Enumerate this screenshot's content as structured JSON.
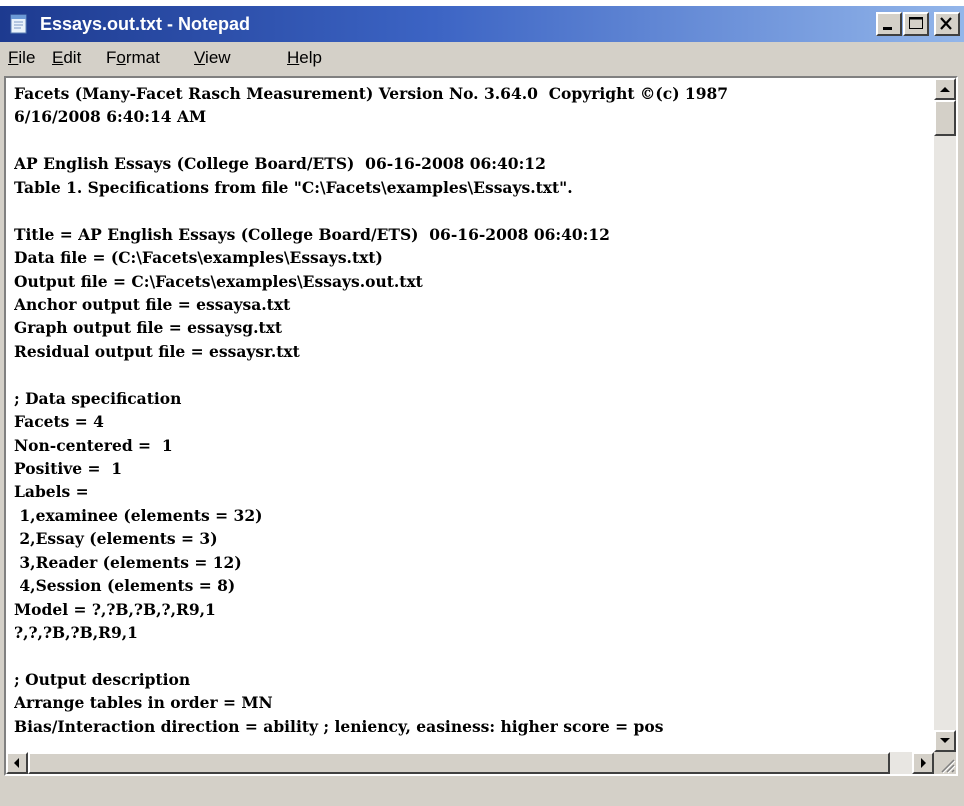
{
  "window": {
    "title": "Essays.out.txt - Notepad",
    "icon": "notepad-icon",
    "titlebar_color_start": "#1d3a8f",
    "titlebar_color_end": "#93b6ea"
  },
  "menu": {
    "items": [
      {
        "accel": "F",
        "rest": "ile"
      },
      {
        "accel": "E",
        "rest": "dit"
      },
      {
        "pre": "F",
        "accel": "o",
        "rest": "rmat"
      },
      {
        "accel": "V",
        "rest": "iew"
      },
      {
        "accel": "H",
        "rest": "elp"
      }
    ]
  },
  "document": {
    "lines": [
      "Facets (Many-Facet Rasch Measurement) Version No. 3.64.0  Copyright ©(c) 1987",
      "6/16/2008 6:40:14 AM",
      "",
      "AP English Essays (College Board/ETS)  06-16-2008 06:40:12",
      "Table 1. Specifications from file \"C:\\Facets\\examples\\Essays.txt\".",
      "",
      "Title = AP English Essays (College Board/ETS)  06-16-2008 06:40:12",
      "Data file = (C:\\Facets\\examples\\Essays.txt)",
      "Output file = C:\\Facets\\examples\\Essays.out.txt",
      "Anchor output file = essaysa.txt",
      "Graph output file = essaysg.txt",
      "Residual output file = essaysr.txt",
      "",
      "; Data specification",
      "Facets = 4",
      "Non-centered =  1",
      "Positive =  1",
      "Labels =",
      " 1,examinee (elements = 32)",
      " 2,Essay (elements = 3)",
      " 3,Reader (elements = 12)",
      " 4,Session (elements = 8)",
      "Model = ?,?B,?B,?,R9,1",
      "?,?,?B,?B,R9,1",
      "",
      "; Output description",
      "Arrange tables in order = MN",
      "Bias/Interaction direction = ability ; leniency, easiness: higher score = pos"
    ]
  },
  "icons": {
    "minimize": "minimize-icon",
    "maximize": "maximize-icon",
    "close": "close-icon",
    "scroll_up": "arrow-up-icon",
    "scroll_down": "arrow-down-icon",
    "scroll_left": "arrow-left-icon",
    "scroll_right": "arrow-right-icon",
    "resize": "resize-grip-icon"
  }
}
